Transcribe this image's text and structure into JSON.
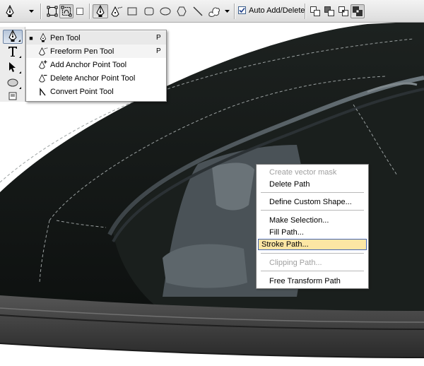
{
  "options_bar": {
    "icons": [
      "pen-tool-icon",
      "tool-preset-dropdown-icon",
      "shape-layers-icon",
      "paths-icon",
      "fill-pixels-icon",
      "pen-icon",
      "freeform-pen-icon",
      "rectangle-icon",
      "rounded-rectangle-icon",
      "ellipse-icon",
      "polygon-icon",
      "line-icon",
      "custom-shape-icon",
      "shape-dropdown-icon",
      "add-to-path-area-icon",
      "subtract-from-path-area-icon",
      "intersect-path-areas-icon",
      "exclude-overlapping-path-areas-icon"
    ],
    "auto_add_delete": {
      "label": "Auto Add/Delete",
      "checked": true
    }
  },
  "tools_panel": {
    "items": [
      "pen-tool-icon",
      "type-tool-icon",
      "path-selection-tool-icon",
      "ellipse-tool-icon",
      "notes-tool-icon"
    ],
    "active": "pen-tool-icon"
  },
  "tool_flyout": {
    "items": [
      {
        "label": "Pen Tool",
        "shortcut": "P",
        "selected": true,
        "icon": "pen-icon"
      },
      {
        "label": "Freeform Pen Tool",
        "shortcut": "P",
        "selected": false,
        "icon": "freeform-pen-icon"
      },
      {
        "label": "Add Anchor Point Tool",
        "shortcut": "",
        "selected": false,
        "icon": "add-anchor-point-icon"
      },
      {
        "label": "Delete Anchor Point Tool",
        "shortcut": "",
        "selected": false,
        "icon": "delete-anchor-point-icon"
      },
      {
        "label": "Convert Point Tool",
        "shortcut": "",
        "selected": false,
        "icon": "convert-point-icon"
      }
    ]
  },
  "context_menu": {
    "items": [
      {
        "label": "Create vector mask",
        "disabled": true
      },
      {
        "label": "Delete Path",
        "disabled": false
      },
      {
        "label": "Define Custom Shape...",
        "disabled": false
      },
      {
        "label": "Make Selection...",
        "disabled": false
      },
      {
        "label": "Fill Path...",
        "disabled": false
      },
      {
        "label": "Stroke Path...",
        "disabled": false,
        "highlighted": true
      },
      {
        "label": "Clipping Path...",
        "disabled": true
      },
      {
        "label": "Free Transform Path",
        "disabled": false
      }
    ]
  },
  "colors": {
    "shoe_body": "#121614",
    "sole": "#3a3a3a",
    "menu_highlight": "#fce6a4",
    "menu_highlight_border": "#4566b5",
    "disabled_text": "#a0a0a0"
  }
}
